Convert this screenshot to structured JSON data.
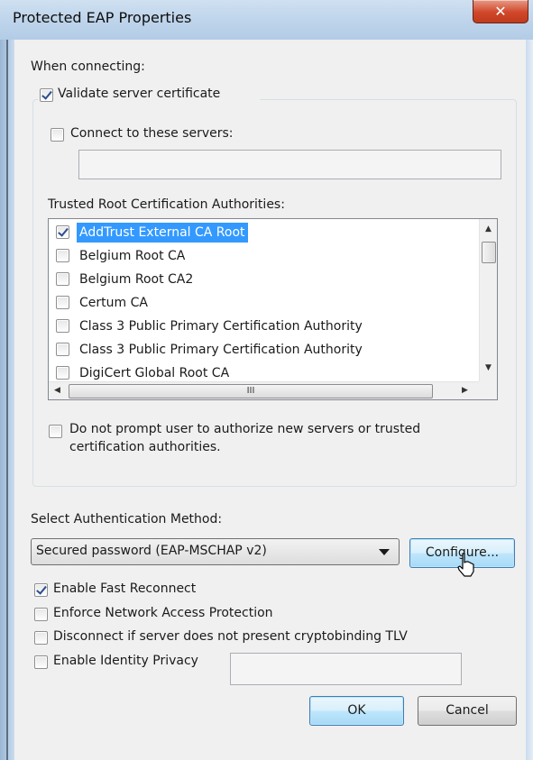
{
  "window": {
    "title": "Protected EAP Properties",
    "close_glyph": "✕"
  },
  "when_connecting": {
    "label": "When connecting:",
    "validate_server_certificate": {
      "label": "Validate server certificate",
      "checked": true
    },
    "connect_to_these_servers": {
      "label": "Connect to these servers:",
      "checked": false,
      "value": ""
    }
  },
  "trusted_roots": {
    "label": "Trusted Root Certification Authorities:",
    "items": [
      {
        "label": "AddTrust External CA Root",
        "checked": true,
        "selected": true
      },
      {
        "label": "Belgium Root CA",
        "checked": false,
        "selected": false
      },
      {
        "label": "Belgium Root CA2",
        "checked": false,
        "selected": false
      },
      {
        "label": "Certum CA",
        "checked": false,
        "selected": false
      },
      {
        "label": "Class 3 Public Primary Certification Authority",
        "checked": false,
        "selected": false
      },
      {
        "label": "Class 3 Public Primary Certification Authority",
        "checked": false,
        "selected": false
      },
      {
        "label": "DigiCert Global Root CA",
        "checked": false,
        "selected": false
      }
    ],
    "hscroll_grip": "III"
  },
  "do_not_prompt": {
    "label_line1": "Do not prompt user to authorize new servers or trusted",
    "label_line2": "certification authorities.",
    "checked": false
  },
  "auth_method": {
    "label": "Select Authentication Method:",
    "selected": "Secured password (EAP-MSCHAP v2)",
    "configure_label": "Configure..."
  },
  "options": {
    "enable_fast_reconnect": {
      "label": "Enable Fast Reconnect",
      "checked": true
    },
    "enforce_nap": {
      "label": "Enforce Network Access Protection",
      "checked": false
    },
    "disconnect_cryptobinding": {
      "label": "Disconnect if server does not present cryptobinding TLV",
      "checked": false
    },
    "enable_identity_privacy": {
      "label": "Enable Identity Privacy",
      "checked": false,
      "value": ""
    }
  },
  "buttons": {
    "ok": "OK",
    "cancel": "Cancel"
  },
  "icons": {
    "close": "close-icon",
    "combo_arrow": "dropdown-arrow-icon",
    "cursor": "mouse-pointer-icon"
  },
  "colors": {
    "selection": "#3399ff",
    "close_button": "#c13a1c",
    "title_bar": "#bcd3ea"
  }
}
